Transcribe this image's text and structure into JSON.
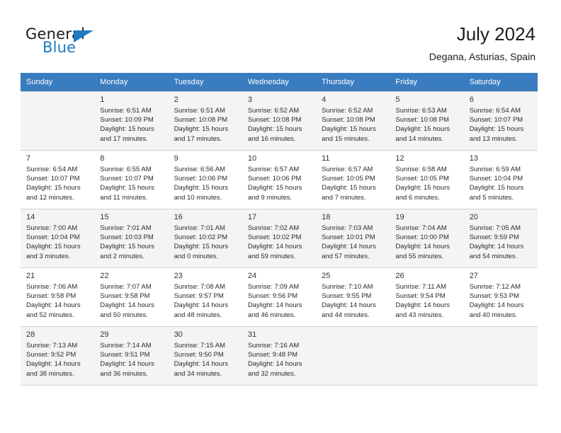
{
  "brand": {
    "name_part1": "General",
    "name_part2": "Blue",
    "accent_color": "#1f7ac0"
  },
  "header": {
    "month_title": "July 2024",
    "location": "Degana, Asturias, Spain"
  },
  "calendar": {
    "header_bg": "#3a7cc0",
    "weekday_headers": [
      "Sunday",
      "Monday",
      "Tuesday",
      "Wednesday",
      "Thursday",
      "Friday",
      "Saturday"
    ],
    "weeks": [
      {
        "shaded": true,
        "days": [
          {
            "num": "",
            "lines": []
          },
          {
            "num": "1",
            "lines": [
              "Sunrise: 6:51 AM",
              "Sunset: 10:09 PM",
              "Daylight: 15 hours",
              "and 17 minutes."
            ]
          },
          {
            "num": "2",
            "lines": [
              "Sunrise: 6:51 AM",
              "Sunset: 10:08 PM",
              "Daylight: 15 hours",
              "and 17 minutes."
            ]
          },
          {
            "num": "3",
            "lines": [
              "Sunrise: 6:52 AM",
              "Sunset: 10:08 PM",
              "Daylight: 15 hours",
              "and 16 minutes."
            ]
          },
          {
            "num": "4",
            "lines": [
              "Sunrise: 6:52 AM",
              "Sunset: 10:08 PM",
              "Daylight: 15 hours",
              "and 15 minutes."
            ]
          },
          {
            "num": "5",
            "lines": [
              "Sunrise: 6:53 AM",
              "Sunset: 10:08 PM",
              "Daylight: 15 hours",
              "and 14 minutes."
            ]
          },
          {
            "num": "6",
            "lines": [
              "Sunrise: 6:54 AM",
              "Sunset: 10:07 PM",
              "Daylight: 15 hours",
              "and 13 minutes."
            ]
          }
        ]
      },
      {
        "shaded": false,
        "days": [
          {
            "num": "7",
            "lines": [
              "Sunrise: 6:54 AM",
              "Sunset: 10:07 PM",
              "Daylight: 15 hours",
              "and 12 minutes."
            ]
          },
          {
            "num": "8",
            "lines": [
              "Sunrise: 6:55 AM",
              "Sunset: 10:07 PM",
              "Daylight: 15 hours",
              "and 11 minutes."
            ]
          },
          {
            "num": "9",
            "lines": [
              "Sunrise: 6:56 AM",
              "Sunset: 10:06 PM",
              "Daylight: 15 hours",
              "and 10 minutes."
            ]
          },
          {
            "num": "10",
            "lines": [
              "Sunrise: 6:57 AM",
              "Sunset: 10:06 PM",
              "Daylight: 15 hours",
              "and 9 minutes."
            ]
          },
          {
            "num": "11",
            "lines": [
              "Sunrise: 6:57 AM",
              "Sunset: 10:05 PM",
              "Daylight: 15 hours",
              "and 7 minutes."
            ]
          },
          {
            "num": "12",
            "lines": [
              "Sunrise: 6:58 AM",
              "Sunset: 10:05 PM",
              "Daylight: 15 hours",
              "and 6 minutes."
            ]
          },
          {
            "num": "13",
            "lines": [
              "Sunrise: 6:59 AM",
              "Sunset: 10:04 PM",
              "Daylight: 15 hours",
              "and 5 minutes."
            ]
          }
        ]
      },
      {
        "shaded": true,
        "days": [
          {
            "num": "14",
            "lines": [
              "Sunrise: 7:00 AM",
              "Sunset: 10:04 PM",
              "Daylight: 15 hours",
              "and 3 minutes."
            ]
          },
          {
            "num": "15",
            "lines": [
              "Sunrise: 7:01 AM",
              "Sunset: 10:03 PM",
              "Daylight: 15 hours",
              "and 2 minutes."
            ]
          },
          {
            "num": "16",
            "lines": [
              "Sunrise: 7:01 AM",
              "Sunset: 10:02 PM",
              "Daylight: 15 hours",
              "and 0 minutes."
            ]
          },
          {
            "num": "17",
            "lines": [
              "Sunrise: 7:02 AM",
              "Sunset: 10:02 PM",
              "Daylight: 14 hours",
              "and 59 minutes."
            ]
          },
          {
            "num": "18",
            "lines": [
              "Sunrise: 7:03 AM",
              "Sunset: 10:01 PM",
              "Daylight: 14 hours",
              "and 57 minutes."
            ]
          },
          {
            "num": "19",
            "lines": [
              "Sunrise: 7:04 AM",
              "Sunset: 10:00 PM",
              "Daylight: 14 hours",
              "and 55 minutes."
            ]
          },
          {
            "num": "20",
            "lines": [
              "Sunrise: 7:05 AM",
              "Sunset: 9:59 PM",
              "Daylight: 14 hours",
              "and 54 minutes."
            ]
          }
        ]
      },
      {
        "shaded": false,
        "days": [
          {
            "num": "21",
            "lines": [
              "Sunrise: 7:06 AM",
              "Sunset: 9:58 PM",
              "Daylight: 14 hours",
              "and 52 minutes."
            ]
          },
          {
            "num": "22",
            "lines": [
              "Sunrise: 7:07 AM",
              "Sunset: 9:58 PM",
              "Daylight: 14 hours",
              "and 50 minutes."
            ]
          },
          {
            "num": "23",
            "lines": [
              "Sunrise: 7:08 AM",
              "Sunset: 9:57 PM",
              "Daylight: 14 hours",
              "and 48 minutes."
            ]
          },
          {
            "num": "24",
            "lines": [
              "Sunrise: 7:09 AM",
              "Sunset: 9:56 PM",
              "Daylight: 14 hours",
              "and 46 minutes."
            ]
          },
          {
            "num": "25",
            "lines": [
              "Sunrise: 7:10 AM",
              "Sunset: 9:55 PM",
              "Daylight: 14 hours",
              "and 44 minutes."
            ]
          },
          {
            "num": "26",
            "lines": [
              "Sunrise: 7:11 AM",
              "Sunset: 9:54 PM",
              "Daylight: 14 hours",
              "and 43 minutes."
            ]
          },
          {
            "num": "27",
            "lines": [
              "Sunrise: 7:12 AM",
              "Sunset: 9:53 PM",
              "Daylight: 14 hours",
              "and 40 minutes."
            ]
          }
        ]
      },
      {
        "shaded": true,
        "days": [
          {
            "num": "28",
            "lines": [
              "Sunrise: 7:13 AM",
              "Sunset: 9:52 PM",
              "Daylight: 14 hours",
              "and 38 minutes."
            ]
          },
          {
            "num": "29",
            "lines": [
              "Sunrise: 7:14 AM",
              "Sunset: 9:51 PM",
              "Daylight: 14 hours",
              "and 36 minutes."
            ]
          },
          {
            "num": "30",
            "lines": [
              "Sunrise: 7:15 AM",
              "Sunset: 9:50 PM",
              "Daylight: 14 hours",
              "and 34 minutes."
            ]
          },
          {
            "num": "31",
            "lines": [
              "Sunrise: 7:16 AM",
              "Sunset: 9:48 PM",
              "Daylight: 14 hours",
              "and 32 minutes."
            ]
          },
          {
            "num": "",
            "lines": []
          },
          {
            "num": "",
            "lines": []
          },
          {
            "num": "",
            "lines": []
          }
        ]
      }
    ]
  }
}
